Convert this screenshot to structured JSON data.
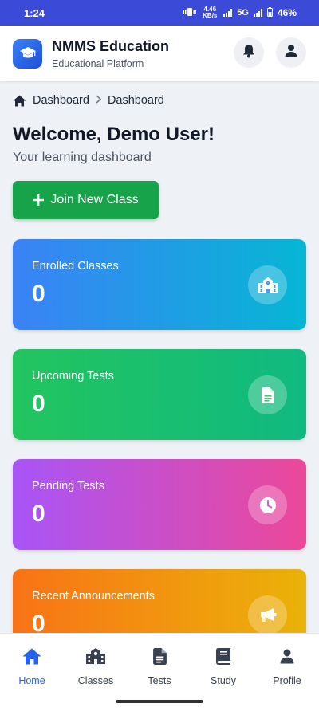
{
  "status_bar": {
    "time": "1:24",
    "network_speed": "4.46 KB/s",
    "network_type": "5G",
    "battery": "46%"
  },
  "header": {
    "title": "NMMS Education",
    "subtitle": "Educational Platform",
    "logo_icon": "graduation-cap-icon",
    "notification_icon": "bell-icon",
    "profile_icon": "user-icon"
  },
  "breadcrumb": {
    "home_label": "Dashboard",
    "current_label": "Dashboard"
  },
  "welcome": {
    "title": "Welcome, Demo User!",
    "subtitle": "Your learning dashboard"
  },
  "join_button": {
    "label": "Join New Class"
  },
  "stats": [
    {
      "label": "Enrolled Classes",
      "value": "0",
      "icon": "school-icon",
      "color_from": "#3b82f6",
      "color_to": "#06b6d4"
    },
    {
      "label": "Upcoming Tests",
      "value": "0",
      "icon": "document-icon",
      "color_from": "#22c55e",
      "color_to": "#10b981"
    },
    {
      "label": "Pending Tests",
      "value": "0",
      "icon": "clock-icon",
      "color_from": "#a855f7",
      "color_to": "#ec4899"
    },
    {
      "label": "Recent Announcements",
      "value": "0",
      "icon": "megaphone-icon",
      "color_from": "#f97316",
      "color_to": "#eab308"
    }
  ],
  "bottom_nav": {
    "items": [
      {
        "label": "Home",
        "icon": "home-icon",
        "active": true
      },
      {
        "label": "Classes",
        "icon": "school-icon",
        "active": false
      },
      {
        "label": "Tests",
        "icon": "document-icon",
        "active": false
      },
      {
        "label": "Study",
        "icon": "book-icon",
        "active": false
      },
      {
        "label": "Profile",
        "icon": "user-icon",
        "active": false
      }
    ]
  },
  "colors": {
    "accent": "#2563eb",
    "join_button": "#16a34a"
  }
}
